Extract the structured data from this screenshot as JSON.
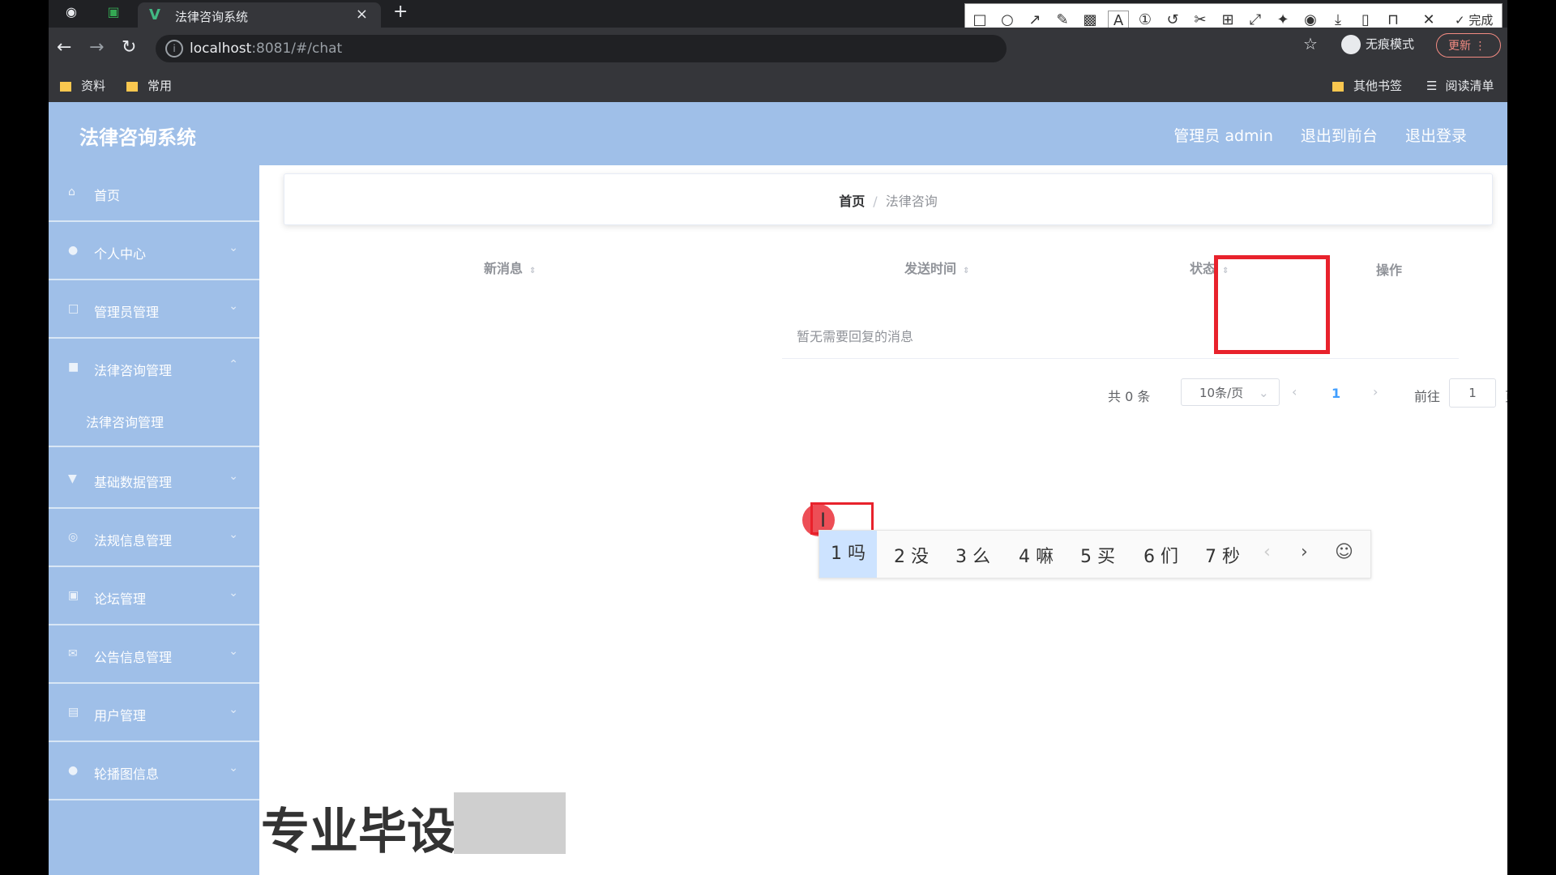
{
  "browser": {
    "tab_title": "法律咨询系统",
    "tab_close": "×",
    "new_tab": "+",
    "url_host": "localhost",
    "url_rest": ":8081/#/chat",
    "incognito_label": "无痕模式",
    "update_label": "更新",
    "bookmarks": [
      "资料",
      "常用"
    ],
    "bookmarks_right": [
      "其他书签",
      "阅读清单"
    ]
  },
  "screenshot_tool": {
    "done_label": "完成",
    "font_size": "12",
    "palette": [
      "#000000",
      "#808080",
      "#800000",
      "#f08c3c",
      "#2e8b57",
      "#2f6fd6",
      "#800080",
      "#20b2aa",
      "#ffffff",
      "#c0c0c0",
      "#f03e3e",
      "#ffeb3b",
      "#7cb342",
      "#42a5f5",
      "#e040fb",
      "#26c6da"
    ],
    "current_color": "#f03e3e"
  },
  "header": {
    "logo": "法律咨询系统",
    "admin": "管理员 admin",
    "back_front": "退出到前台",
    "logout": "退出登录"
  },
  "sidebar": {
    "items": [
      {
        "label": "首页",
        "icon": "home-icon"
      },
      {
        "label": "个人中心",
        "icon": "user-icon"
      },
      {
        "label": "管理员管理",
        "icon": "admin-icon"
      },
      {
        "label": "法律咨询管理",
        "icon": "consult-icon"
      },
      {
        "label": "基础数据管理",
        "icon": "data-icon"
      },
      {
        "label": "法规信息管理",
        "icon": "law-icon"
      },
      {
        "label": "论坛管理",
        "icon": "forum-icon"
      },
      {
        "label": "公告信息管理",
        "icon": "notice-icon"
      },
      {
        "label": "用户管理",
        "icon": "users-icon"
      },
      {
        "label": "轮播图信息",
        "icon": "carousel-icon"
      }
    ],
    "submenu": "法律咨询管理"
  },
  "breadcrumb": {
    "home": "首页",
    "sep": "/",
    "current": "法律咨询"
  },
  "table": {
    "columns": [
      "新消息",
      "发送时间",
      "状态",
      "操作"
    ],
    "empty": "暂无需要回复的消息"
  },
  "pagination": {
    "total": "共 0 条",
    "page_size": "10条/页",
    "current_page": "1",
    "goto_label": "前往",
    "goto_value": "1",
    "page_suffix": "页"
  },
  "ime": {
    "candidates": [
      "1 吗",
      "2 没",
      "3 么",
      "4 嘛",
      "5 买",
      "6 们",
      "7 秒"
    ]
  },
  "watermark": "专业毕设"
}
